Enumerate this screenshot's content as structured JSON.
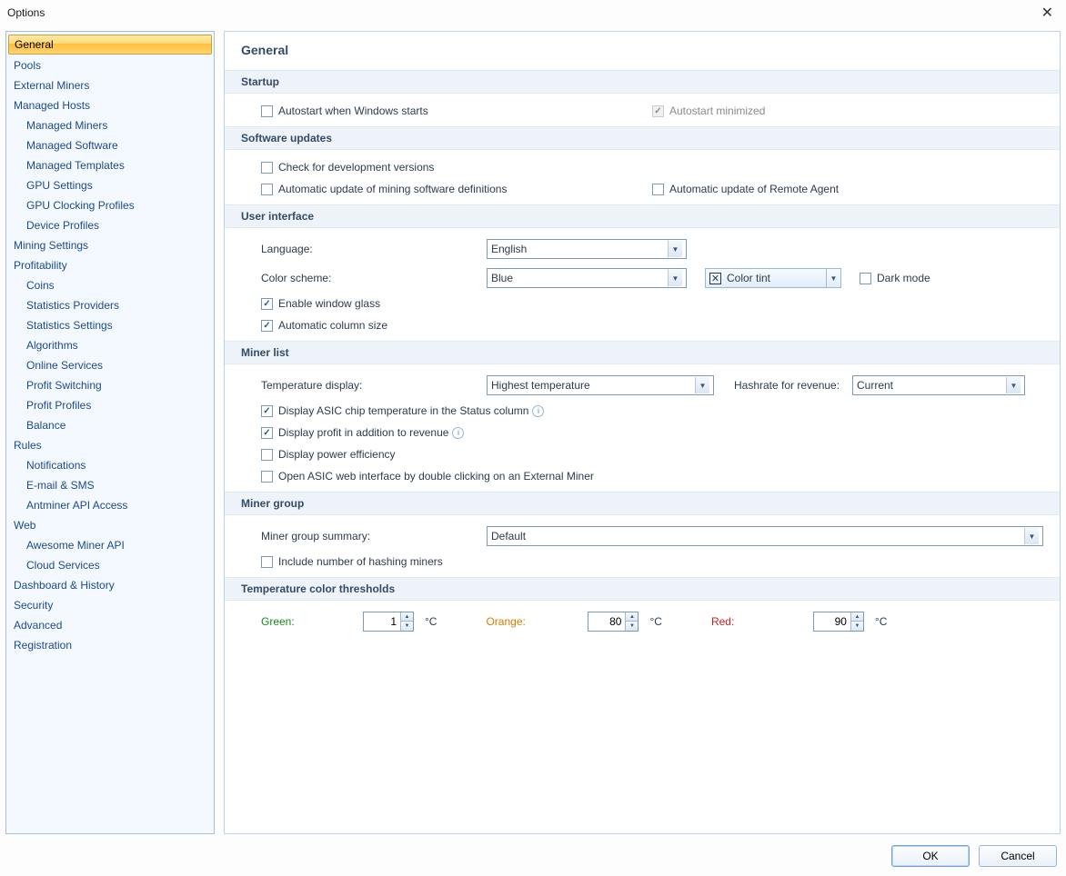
{
  "window": {
    "title": "Options"
  },
  "sidebar": {
    "items": [
      {
        "label": "General",
        "selected": true
      },
      {
        "label": "Pools"
      },
      {
        "label": "External Miners"
      },
      {
        "label": "Managed Hosts"
      },
      {
        "label": "Managed Miners",
        "child": true
      },
      {
        "label": "Managed Software",
        "child": true
      },
      {
        "label": "Managed Templates",
        "child": true
      },
      {
        "label": "GPU Settings",
        "child": true
      },
      {
        "label": "GPU Clocking Profiles",
        "child": true
      },
      {
        "label": "Device Profiles",
        "child": true
      },
      {
        "label": "Mining Settings"
      },
      {
        "label": "Profitability"
      },
      {
        "label": "Coins",
        "child": true
      },
      {
        "label": "Statistics Providers",
        "child": true
      },
      {
        "label": "Statistics Settings",
        "child": true
      },
      {
        "label": "Algorithms",
        "child": true
      },
      {
        "label": "Online Services",
        "child": true
      },
      {
        "label": "Profit Switching",
        "child": true
      },
      {
        "label": "Profit Profiles",
        "child": true
      },
      {
        "label": "Balance",
        "child": true
      },
      {
        "label": "Rules"
      },
      {
        "label": "Notifications",
        "child": true
      },
      {
        "label": "E-mail & SMS",
        "child": true
      },
      {
        "label": "Antminer API Access",
        "child": true
      },
      {
        "label": "Web"
      },
      {
        "label": "Awesome Miner API",
        "child": true
      },
      {
        "label": "Cloud Services",
        "child": true
      },
      {
        "label": "Dashboard & History"
      },
      {
        "label": "Security"
      },
      {
        "label": "Advanced"
      },
      {
        "label": "Registration"
      }
    ]
  },
  "page": {
    "title": "General",
    "sections": {
      "startup": {
        "title": "Startup",
        "autostart": "Autostart when Windows starts",
        "autostart_min": "Autostart minimized"
      },
      "updates": {
        "title": "Software updates",
        "dev": "Check for development versions",
        "defs": "Automatic update of mining software definitions",
        "agent": "Automatic update of Remote Agent"
      },
      "ui": {
        "title": "User interface",
        "language_label": "Language:",
        "language_value": "English",
        "scheme_label": "Color scheme:",
        "scheme_value": "Blue",
        "colortint": "Color tint",
        "darkmode": "Dark mode",
        "glass": "Enable window glass",
        "autocol": "Automatic column size"
      },
      "minerlist": {
        "title": "Miner list",
        "tempdisp_label": "Temperature display:",
        "tempdisp_value": "Highest temperature",
        "hashrev_label": "Hashrate for revenue:",
        "hashrev_value": "Current",
        "asic_temp": "Display ASIC chip temperature in the Status column",
        "profit": "Display profit in addition to revenue",
        "powereff": "Display power efficiency",
        "openasic": "Open ASIC web interface by double clicking on an External Miner"
      },
      "group": {
        "title": "Miner group",
        "summary_label": "Miner group summary:",
        "summary_value": "Default",
        "include": "Include number of hashing miners"
      },
      "temp": {
        "title": "Temperature color thresholds",
        "green_label": "Green:",
        "green_value": "1",
        "orange_label": "Orange:",
        "orange_value": "80",
        "red_label": "Red:",
        "red_value": "90",
        "unit": "°C"
      }
    }
  },
  "footer": {
    "ok": "OK",
    "cancel": "Cancel"
  }
}
